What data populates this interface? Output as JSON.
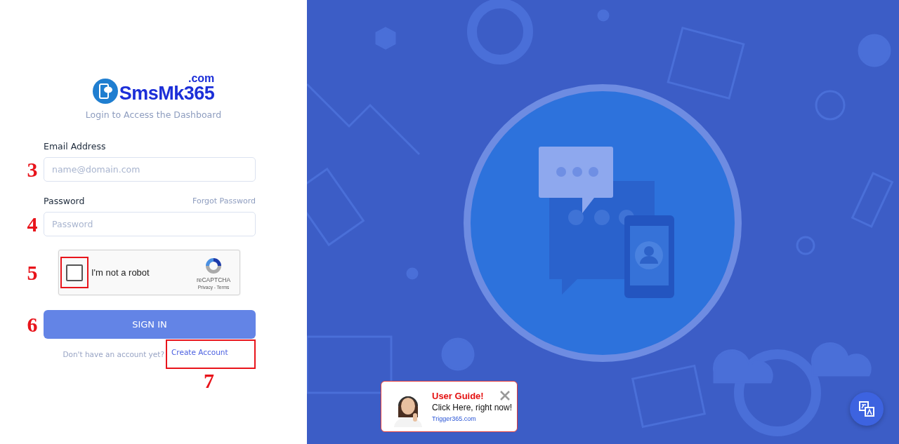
{
  "logo": {
    "text": "SmsMk365",
    "suffix": ".com"
  },
  "subtitle": "Login to Access the Dashboard",
  "email": {
    "label": "Email Address",
    "placeholder": "name@domain.com",
    "annotation": "3"
  },
  "password": {
    "label": "Password",
    "forgot": "Forgot Password",
    "placeholder": "Password",
    "annotation": "4"
  },
  "captcha": {
    "label": "I'm not a robot",
    "checked": false,
    "brand": "reCAPTCHA",
    "links": "Privacy - Terms",
    "annotation": "5"
  },
  "sign_in": {
    "label": "SIGN IN",
    "annotation": "6"
  },
  "signup": {
    "prompt": "Don't have an account yet?",
    "link": "Create Account",
    "annotation": "7"
  },
  "popup": {
    "title": "User Guide!",
    "text": "Click Here, right now!",
    "link": "Trigger365.com"
  }
}
